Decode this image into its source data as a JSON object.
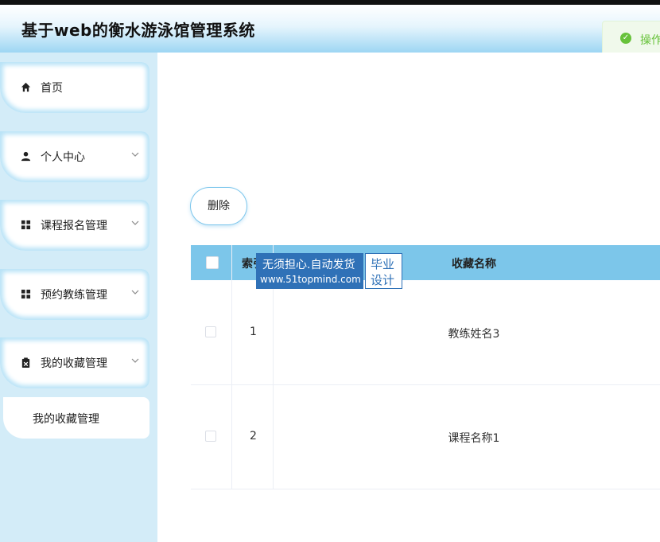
{
  "app": {
    "title": "基于web的衡水游泳馆管理系统"
  },
  "toast": {
    "text": "操作",
    "icon": "check-circle-icon",
    "color": "#67c23a"
  },
  "sidebar": {
    "items": [
      {
        "label": "首页",
        "icon": "home-icon"
      },
      {
        "label": "个人中心",
        "icon": "user-icon"
      },
      {
        "label": "课程报名管理",
        "icon": "grid-icon"
      },
      {
        "label": "预约教练管理",
        "icon": "grid-icon"
      },
      {
        "label": "我的收藏管理",
        "icon": "clipboard-icon"
      }
    ],
    "sub_item": {
      "label": "我的收藏管理"
    }
  },
  "toolbar": {
    "delete_label": "删除"
  },
  "table": {
    "headers": {
      "index": "索引",
      "name": "收藏名称"
    },
    "rows": [
      {
        "index": "1",
        "name": "教练姓名3"
      },
      {
        "index": "2",
        "name": "课程名称1"
      }
    ],
    "header_color": "#7cc6ea"
  },
  "watermark": {
    "line1": "无须担心.自动发货",
    "line2": "www.51topmind.com",
    "right1": "毕业",
    "right2": "设计"
  }
}
